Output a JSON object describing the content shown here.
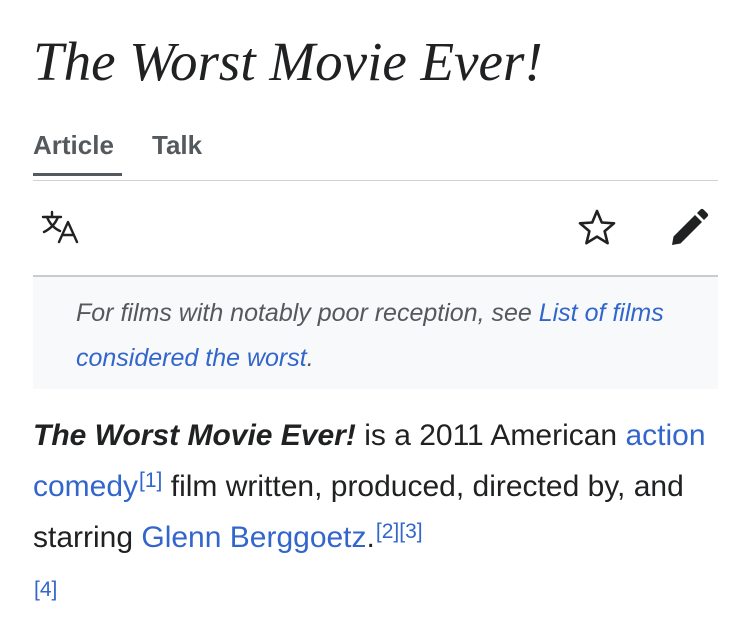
{
  "article": {
    "title": "The Worst Movie Ever!"
  },
  "tabs": [
    {
      "label": "Article",
      "selected": true
    },
    {
      "label": "Talk",
      "selected": false
    }
  ],
  "actions": {
    "icons": [
      "language-icon",
      "star-icon",
      "pencil-icon"
    ]
  },
  "hatnote": {
    "prefix": "For films with notably poor reception, see ",
    "link": "List of films considered the worst",
    "suffix": "."
  },
  "lead": {
    "bold_title": "The Worst Movie Ever!",
    "text1": " is a 2011 American ",
    "link1": "action comedy",
    "ref1": "[1]",
    "text2": " film written, produced, directed by, and starring ",
    "link2": "Glenn Berggoetz",
    "text3": ".",
    "ref2": "[2]",
    "ref3": "[3]",
    "ref4": "[4]"
  },
  "colors": {
    "text": "#202122",
    "link": "#3366cc",
    "tab": "#54595d",
    "hatnote_bg": "#f8f9fa",
    "divider": "#c8ccd1"
  }
}
